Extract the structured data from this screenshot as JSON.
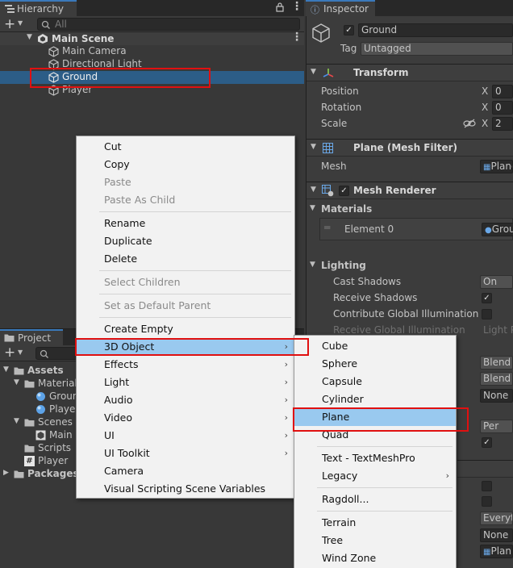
{
  "hierarchy": {
    "title": "Hierarchy",
    "search_placeholder": "All",
    "scene": "Main Scene",
    "items": [
      {
        "label": "Main Camera"
      },
      {
        "label": "Directional Light"
      },
      {
        "label": "Ground"
      },
      {
        "label": "Player"
      }
    ]
  },
  "inspector": {
    "title": "Inspector",
    "object_name": "Ground",
    "tag_label": "Tag",
    "tag_value": "Untagged",
    "transform": {
      "title": "Transform",
      "position_label": "Position",
      "rotation_label": "Rotation",
      "scale_label": "Scale",
      "axis_x": "X",
      "position_x": "0",
      "rotation_x": "0",
      "scale_x": "2"
    },
    "mesh_filter": {
      "title": "Plane (Mesh Filter)",
      "mesh_label": "Mesh",
      "mesh_value": "Plane"
    },
    "mesh_renderer": {
      "title": "Mesh Renderer",
      "materials_label": "Materials",
      "element0_label": "Element 0",
      "element0_value": "Grou",
      "lighting_label": "Lighting",
      "cast_shadows_label": "Cast Shadows",
      "cast_shadows_value": "On",
      "receive_shadows_label": "Receive Shadows",
      "contribute_gi_label": "Contribute Global Illumination",
      "receive_gi_label": "Receive Global Illumination",
      "receive_gi_value": "Light P"
    },
    "partial_values": [
      "Blend",
      "Blend",
      "None (",
      "Per Ob",
      "Everyt",
      "None (",
      "Plan"
    ]
  },
  "project": {
    "title": "Project",
    "tree": {
      "assets": "Assets",
      "materials": "Material",
      "ground": "Groun",
      "player_mat": "Playe",
      "scenes": "Scenes",
      "main_scene": "Main S",
      "scripts": "Scripts",
      "player_script": "Player",
      "packages": "Packages"
    }
  },
  "context_menu": {
    "items": [
      {
        "label": "Cut",
        "disabled": false
      },
      {
        "label": "Copy",
        "disabled": false
      },
      {
        "label": "Paste",
        "disabled": true
      },
      {
        "label": "Paste As Child",
        "disabled": true
      },
      {
        "label": "Rename",
        "disabled": false
      },
      {
        "label": "Duplicate",
        "disabled": false
      },
      {
        "label": "Delete",
        "disabled": false
      },
      {
        "label": "Select Children",
        "disabled": true
      },
      {
        "label": "Set as Default Parent",
        "disabled": true
      },
      {
        "label": "Create Empty",
        "disabled": false
      },
      {
        "label": "3D Object",
        "disabled": false,
        "submenu": true,
        "highlighted": true
      },
      {
        "label": "Effects",
        "submenu": true
      },
      {
        "label": "Light",
        "submenu": true
      },
      {
        "label": "Audio",
        "submenu": true
      },
      {
        "label": "Video",
        "submenu": true
      },
      {
        "label": "UI",
        "submenu": true
      },
      {
        "label": "UI Toolkit",
        "submenu": true
      },
      {
        "label": "Camera"
      },
      {
        "label": "Visual Scripting Scene Variables"
      }
    ]
  },
  "submenu_3d": {
    "items": [
      {
        "label": "Cube"
      },
      {
        "label": "Sphere"
      },
      {
        "label": "Capsule"
      },
      {
        "label": "Cylinder"
      },
      {
        "label": "Plane",
        "highlighted": true
      },
      {
        "label": "Quad"
      },
      {
        "label": "Text - TextMeshPro"
      },
      {
        "label": "Legacy",
        "submenu": true
      },
      {
        "label": "Ragdoll..."
      },
      {
        "label": "Terrain"
      },
      {
        "label": "Tree"
      },
      {
        "label": "Wind Zone"
      }
    ]
  },
  "colors": {
    "selection": "#2c5d87",
    "menu_highlight": "#99c9ef",
    "annotation_red": "#e01010",
    "accent": "#3a79bb"
  }
}
